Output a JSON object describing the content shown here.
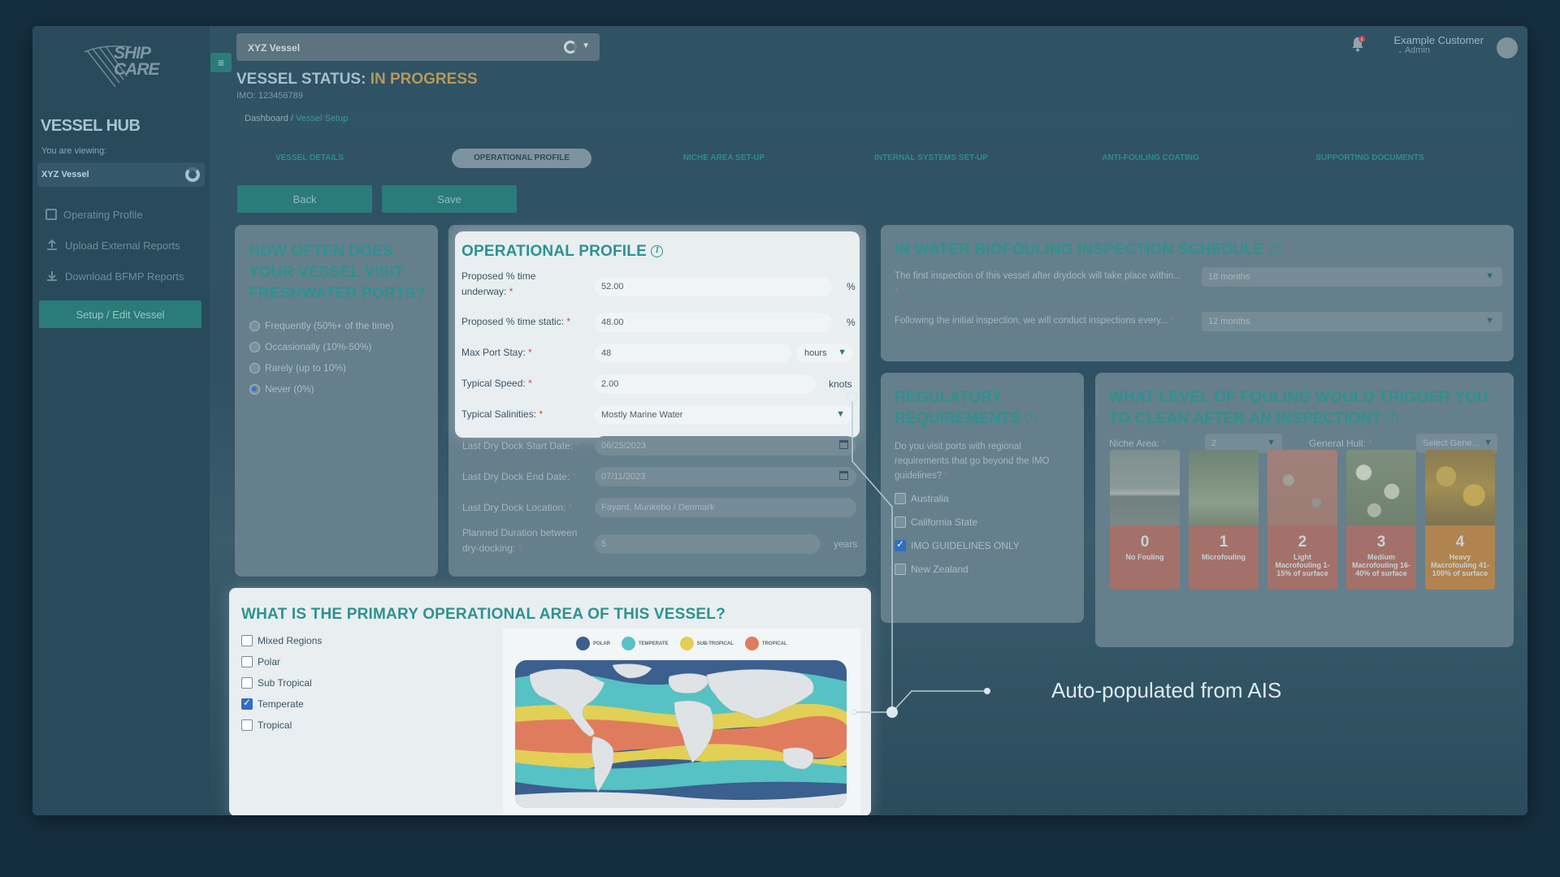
{
  "sidebar": {
    "logo_text": "SHIP\nCARE",
    "hub_title": "VESSEL HUB",
    "viewing_label": "You are viewing:",
    "viewing_value": "XYZ Vessel",
    "items": [
      {
        "label": "Operating Profile",
        "icon": "document-icon"
      },
      {
        "label": "Upload External Reports",
        "icon": "upload-icon"
      },
      {
        "label": "Download BFMP Reports",
        "icon": "download-icon"
      }
    ],
    "setup_button": "Setup / Edit Vessel"
  },
  "header": {
    "vessel_select": "XYZ Vessel",
    "status_prefix": "VESSEL STATUS: ",
    "status_value": "IN PROGRESS",
    "imo": "IMO: 123456789",
    "user_name": "Example Customer",
    "user_role": "Admin",
    "notification_count": "4"
  },
  "breadcrumb": {
    "root": "Dashboard",
    "sep": " / ",
    "current": "Vessel Setup"
  },
  "tabs": [
    {
      "label": "VESSEL DETAILS",
      "active": false
    },
    {
      "label": "OPERATIONAL PROFILE",
      "active": true
    },
    {
      "label": "NICHE AREA SET-UP",
      "active": false
    },
    {
      "label": "INTERNAL SYSTEMS SET-UP",
      "active": false
    },
    {
      "label": "ANTI-FOULING COATING",
      "active": false
    },
    {
      "label": "SUPPORTING DOCUMENTS",
      "active": false
    }
  ],
  "actions": {
    "back": "Back",
    "save": "Save"
  },
  "freshwater": {
    "title": "HOW OFTEN DOES YOUR VESSEL VISIT FRESHWATER PORTS?",
    "options": [
      "Frequently (50%+ of the time)",
      "Occasionally (10%-50%)",
      "Rarely (up to 10%)",
      "Never (0%)"
    ],
    "selected": "Never (0%)"
  },
  "operational": {
    "title": "OPERATIONAL PROFILE",
    "underway_label": "Proposed % time underway:",
    "underway_value": "52.00",
    "static_label": "Proposed % time static:",
    "static_value": "48.00",
    "port_stay_label": "Max Port Stay:",
    "port_stay_value": "48",
    "port_stay_unit": "hours",
    "speed_label": "Typical Speed:",
    "speed_value": "2.00",
    "speed_unit": "knots",
    "salinity_label": "Typical Salinities:",
    "salinity_value": "Mostly Marine Water",
    "dock_start_label": "Last Dry Dock Start Date:",
    "dock_start_value": "06/25/2023",
    "dock_end_label": "Last Dry Dock End Date:",
    "dock_end_value": "07/11/2023",
    "dock_location_label": "Last Dry Dock Location:",
    "dock_location_value": "Fayard, Munkebo / Denmark",
    "duration_label": "Planned Duration between dry-docking:",
    "duration_value": "5",
    "duration_unit": "years",
    "percent": "%",
    "required": "*"
  },
  "inspection": {
    "title": "IN WATER BIOFOULING INSPECTION SCHEDULE",
    "first_label": "The first inspection of this vessel after drydock will take place within...",
    "first_value": "18 months",
    "following_label": "Following the initial inspection, we will conduct inspections every...",
    "following_value": "12 months"
  },
  "regulatory": {
    "title": "REGULATORY REQUIREMENTS",
    "question": "Do you visit ports with regional requirements that go beyond the IMO guidelines?",
    "options": [
      {
        "label": "Australia",
        "checked": false
      },
      {
        "label": "California State",
        "checked": false
      },
      {
        "label": "IMO GUIDELINES ONLY",
        "checked": true
      },
      {
        "label": "New Zealand",
        "checked": false
      }
    ]
  },
  "fouling": {
    "title": "WHAT LEVEL OF FOULING WOULD TRIGGER YOU TO CLEAN AFTER AN INSPECTION?",
    "niche_label": "Niche Area:",
    "niche_value": "2",
    "hull_label": "General Hull:",
    "hull_value": "Select Gene...",
    "levels": [
      {
        "num": "0",
        "desc": "No Fouling"
      },
      {
        "num": "1",
        "desc": "Microfouling"
      },
      {
        "num": "2",
        "desc": "Light Macrofouling 1-15% of surface"
      },
      {
        "num": "3",
        "desc": "Medium Macrofouling 16-40% of surface"
      },
      {
        "num": "4",
        "desc": "Heavy Macrofouling 41-100% of surface"
      }
    ]
  },
  "area": {
    "title": "WHAT IS THE PRIMARY OPERATIONAL AREA OF THIS VESSEL?",
    "options": [
      {
        "label": "Mixed Regions",
        "checked": false
      },
      {
        "label": "Polar",
        "checked": false
      },
      {
        "label": "Sub Tropical",
        "checked": false
      },
      {
        "label": "Temperate",
        "checked": true
      },
      {
        "label": "Tropical",
        "checked": false
      }
    ],
    "legend": [
      {
        "label": "POLAR",
        "color": "#3b5f8e"
      },
      {
        "label": "TEMPERATE",
        "color": "#56c2c3"
      },
      {
        "label": "SUB-TROPICAL",
        "color": "#e2cf55"
      },
      {
        "label": "TROPICAL",
        "color": "#e07c5e"
      }
    ]
  },
  "callout": {
    "text": "Auto-populated from AIS"
  },
  "colors": {
    "accent": "#2a7b7a",
    "teal_title": "#2d9290",
    "status": "#b49a5b"
  }
}
